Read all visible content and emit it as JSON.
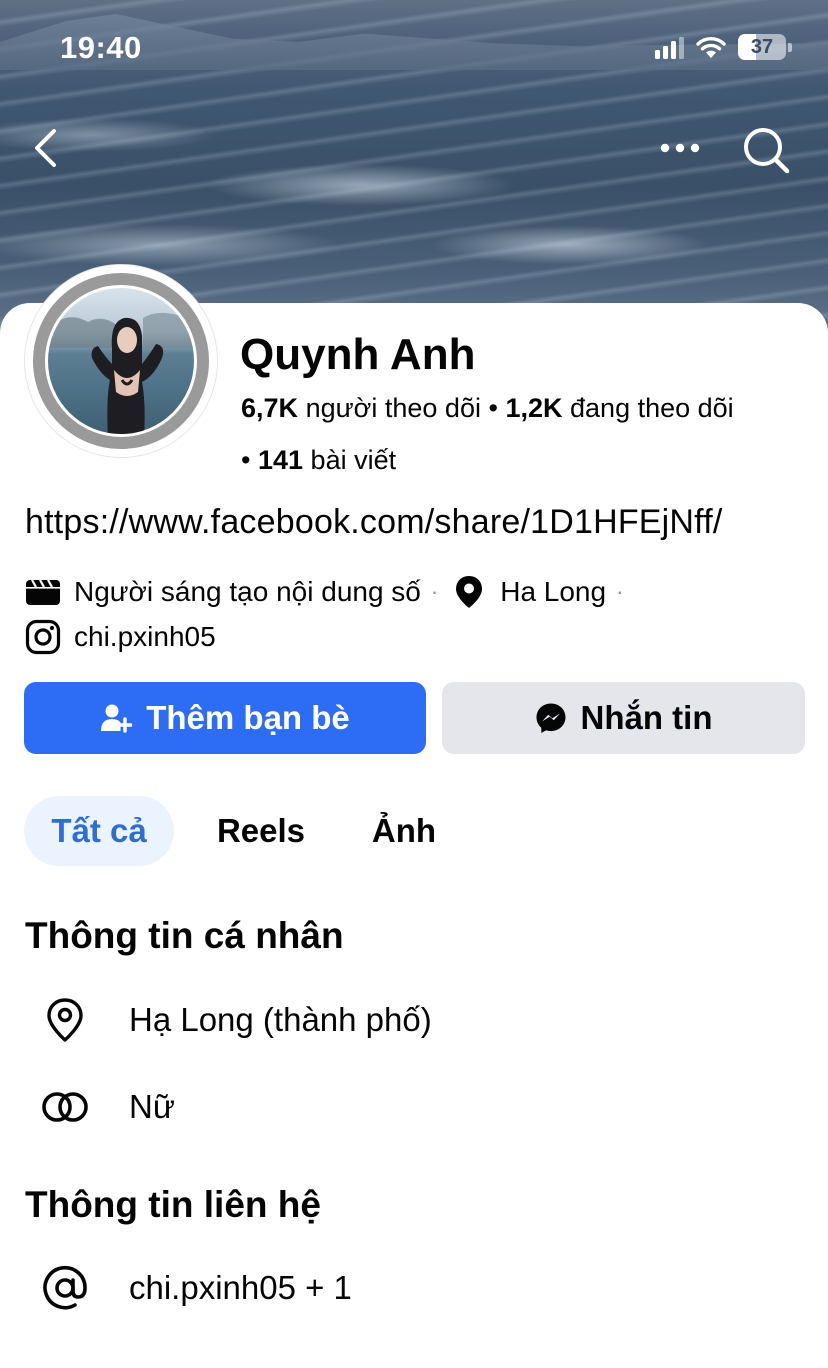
{
  "status_bar": {
    "time": "19:40",
    "battery_level": "37"
  },
  "cover": {
    "description_icons": [
      "back-icon",
      "more-icon",
      "search-icon"
    ]
  },
  "profile": {
    "name": "Quynh Anh",
    "followers_count": "6,7K",
    "followers_label": "người theo dõi",
    "following_count": "1,2K",
    "following_label": "đang theo dõi",
    "posts_count": "141",
    "posts_label": "bài viết",
    "link": "https://www.facebook.com/share/1D1HFEjNff/",
    "category": "Người sáng tạo nội dung số",
    "location": "Ha Long",
    "instagram": "chi.pxinh05"
  },
  "actions": {
    "add_friend_label": "Thêm bạn bè",
    "message_label": "Nhắn tin"
  },
  "tabs": [
    {
      "label": "Tất cả",
      "active": true
    },
    {
      "label": "Reels",
      "active": false
    },
    {
      "label": "Ảnh",
      "active": false
    }
  ],
  "personal_info": {
    "title": "Thông tin cá nhân",
    "city": "Hạ Long (thành phố)",
    "gender": "Nữ"
  },
  "contact_info": {
    "title": "Thông tin liên hệ",
    "instagram": "chi.pxinh05 + 1"
  },
  "colors": {
    "primary_button": "#2d6df6",
    "secondary_button": "#e4e6eb",
    "active_tab_bg": "#ebf3fe",
    "active_tab_text": "#2e6ed0"
  }
}
